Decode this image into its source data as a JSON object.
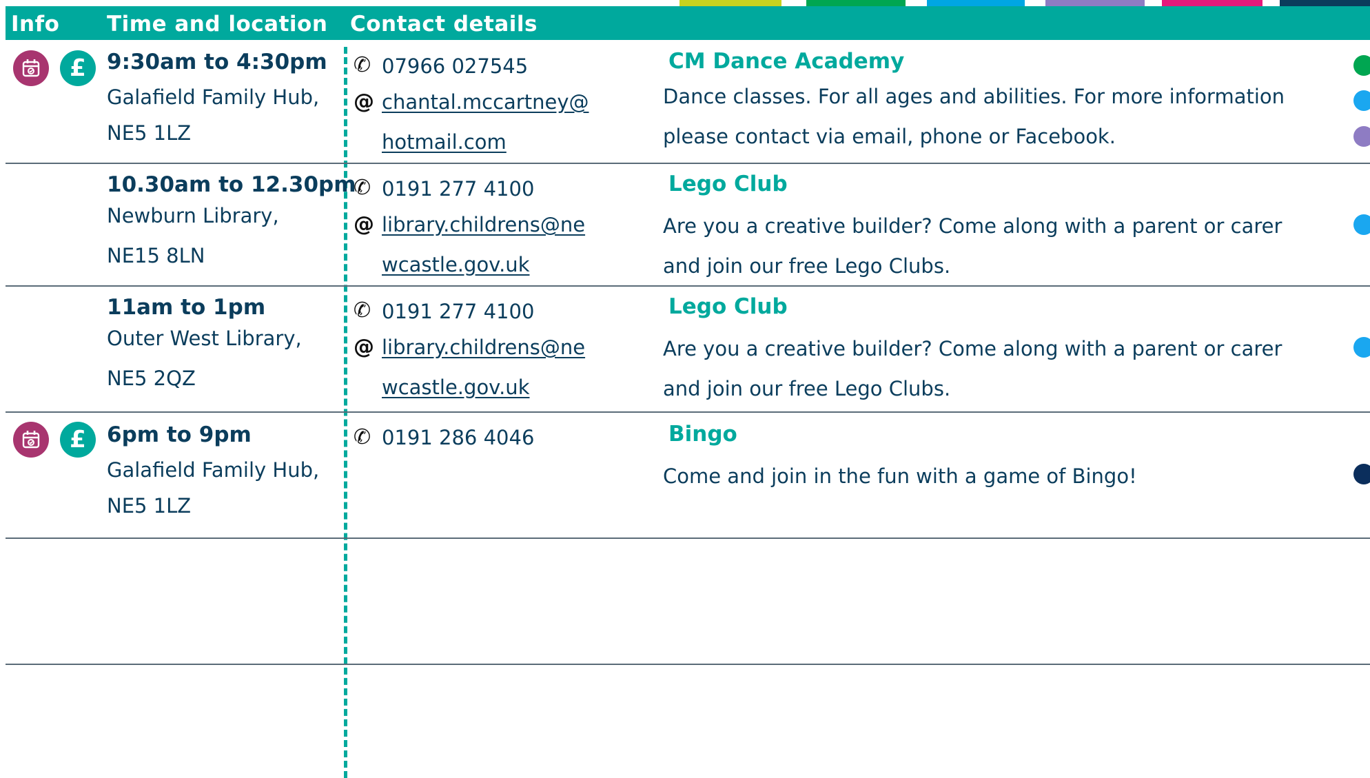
{
  "header": {
    "info": "Info",
    "time_location": "Time and location",
    "contact_details": "Contact details"
  },
  "color_strip": [
    "#c8d21f",
    "#00a651",
    "#00a6e3",
    "#8e7cc3",
    "#e6197b",
    "#0b3d5c"
  ],
  "icons": {
    "calendar_color": "#a8356f",
    "pound_color": "#00a99d",
    "pound_symbol": "£",
    "phone_symbol": "✆",
    "email_symbol": "@"
  },
  "rows": [
    {
      "time": "9:30am to 4:30pm",
      "location_line1": "Galafield Family Hub,",
      "location_line2": "NE5 1LZ",
      "phone": "07966 027545",
      "email_line1": "chantal.mccartney@",
      "email_line2": "hotmail.com",
      "title": "CM Dance Academy",
      "desc_line1": "Dance classes. For all ages and abilities. For more information",
      "desc_line2": "please contact via email, phone or Facebook.",
      "dots": [
        "#00a651",
        "#1aa7f0",
        "#8e7cc3"
      ]
    },
    {
      "time": "10.30am to 12.30pm",
      "location_line1": "Newburn Library,",
      "location_line2": "NE15 8LN",
      "phone": "0191 277 4100",
      "email_line1": "library.childrens@ne",
      "email_line2": "wcastle.gov.uk",
      "title": "Lego Club",
      "desc_line1": "Are you a creative builder? Come along with a parent or carer",
      "desc_line2": "and join our free Lego Clubs.",
      "dots": [
        "#1aa7f0"
      ]
    },
    {
      "time": "11am to 1pm",
      "location_line1": "Outer West Library,",
      "location_line2": "NE5 2QZ",
      "phone": "0191 277 4100",
      "email_line1": "library.childrens@ne",
      "email_line2": "wcastle.gov.uk",
      "title": "Lego Club",
      "desc_line1": "Are you a creative builder? Come along with a parent or carer",
      "desc_line2": "and join our free Lego Clubs.",
      "dots": [
        "#1aa7f0"
      ]
    },
    {
      "time": "6pm to 9pm",
      "location_line1": "Galafield Family Hub,",
      "location_line2": "NE5 1LZ",
      "phone": "0191 286 4046",
      "title": "Bingo",
      "desc_line1": "Come and join in the fun with a game of Bingo!",
      "dots": [
        "#0b2e5c"
      ]
    }
  ]
}
